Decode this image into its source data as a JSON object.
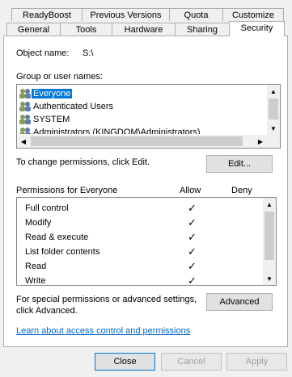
{
  "tabs_row1": [
    "ReadyBoost",
    "Previous Versions",
    "Quota",
    "Customize"
  ],
  "tabs_row2": [
    "General",
    "Tools",
    "Hardware",
    "Sharing",
    "Security"
  ],
  "active_tab": "Security",
  "object": {
    "label": "Object name:",
    "value": "S:\\"
  },
  "groups": {
    "label": "Group or user names:",
    "items": [
      {
        "name": "Everyone",
        "selected": true,
        "icon": "group-users-icon"
      },
      {
        "name": "Authenticated Users",
        "selected": false,
        "icon": "group-users-icon"
      },
      {
        "name": "SYSTEM",
        "selected": false,
        "icon": "group-users-icon"
      },
      {
        "name": "Administrators (KINGDOM\\Administrators)",
        "selected": false,
        "icon": "group-users-icon"
      }
    ]
  },
  "change_text": "To change permissions, click Edit.",
  "edit_label": "Edit...",
  "permissions": {
    "header": "Permissions for Everyone",
    "allow_label": "Allow",
    "deny_label": "Deny",
    "rows": [
      {
        "name": "Full control",
        "allow": true,
        "deny": false
      },
      {
        "name": "Modify",
        "allow": true,
        "deny": false
      },
      {
        "name": "Read & execute",
        "allow": true,
        "deny": false
      },
      {
        "name": "List folder contents",
        "allow": true,
        "deny": false
      },
      {
        "name": "Read",
        "allow": true,
        "deny": false
      },
      {
        "name": "Write",
        "allow": true,
        "deny": false
      }
    ]
  },
  "advanced_text_1": "For special permissions or advanced settings,",
  "advanced_text_2": "click Advanced.",
  "advanced_label": "Advanced",
  "link_text": "Learn about access control and permissions",
  "footer": {
    "close": "Close",
    "cancel": "Cancel",
    "apply": "Apply"
  },
  "check_glyph": "✓",
  "colors": {
    "selection": "#0078d7",
    "link": "#0066cc"
  }
}
